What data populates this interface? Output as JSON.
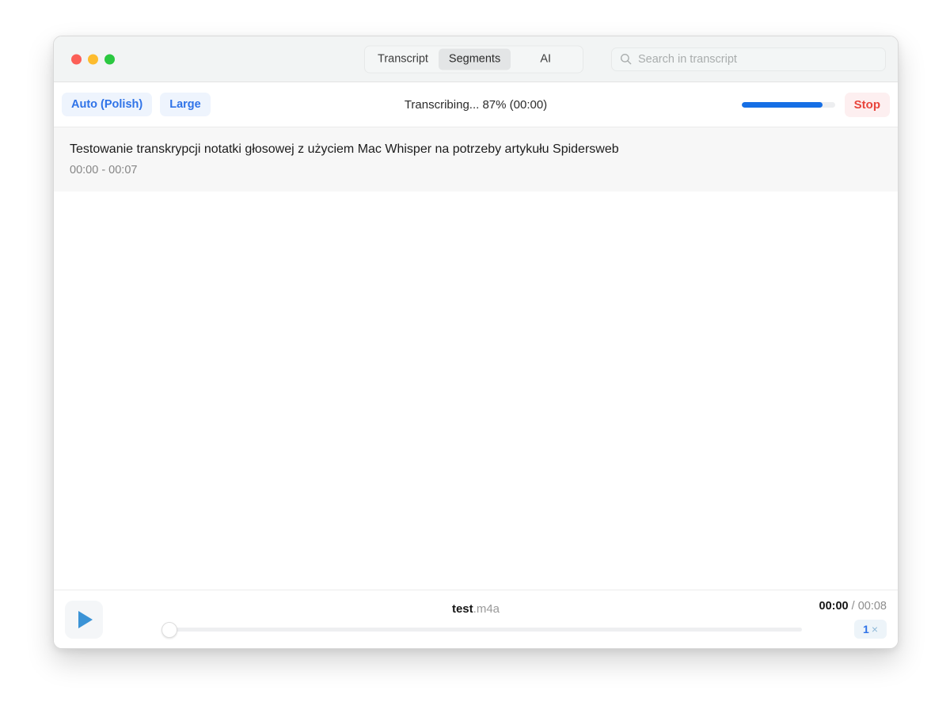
{
  "window": {
    "traffic_lights": [
      {
        "name": "close",
        "color": "#fc5f57"
      },
      {
        "name": "minimize",
        "color": "#fdbc2e"
      },
      {
        "name": "maximize",
        "color": "#2bc840"
      }
    ]
  },
  "titlebar": {
    "tabs": [
      {
        "label": "Transcript",
        "active": false
      },
      {
        "label": "Segments",
        "active": true
      },
      {
        "label": "AI",
        "active": false
      }
    ],
    "search": {
      "icon": "search-icon",
      "placeholder": "Search in transcript",
      "value": ""
    }
  },
  "toolbar": {
    "language_button": "Auto (Polish)",
    "model_button": "Large",
    "status": "Transcribing... 87% (00:00)",
    "progress_percent": 87,
    "stop_button": "Stop",
    "accent_color": "#166fe5",
    "stop_color": "#e8453c"
  },
  "segments": [
    {
      "text": "Testowanie transkrypcji notatki głosowej z użyciem Mac Whisper na potrzeby artykułu Spidersweb",
      "time_range": "00:00 - 00:07"
    }
  ],
  "player": {
    "play_icon": "play-icon",
    "file_base": "test",
    "file_ext": ".m4a",
    "seek_position_percent": 0,
    "current_time": "00:00",
    "time_separator": "/",
    "total_time": "00:08",
    "speed_value": "1",
    "speed_unit": "×"
  }
}
